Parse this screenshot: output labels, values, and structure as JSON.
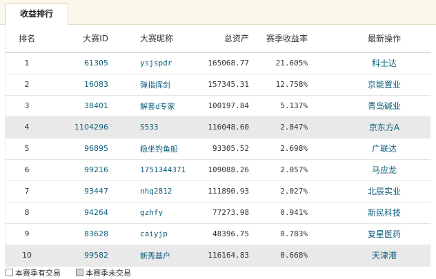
{
  "tab": {
    "label": "收益排行"
  },
  "table": {
    "headers": {
      "rank": "排名",
      "id": "大赛ID",
      "nick": "大赛昵称",
      "asset": "总资产",
      "ret": "赛季收益率",
      "action": "最新操作"
    },
    "rows": [
      {
        "rank": "1",
        "id": "61305",
        "nick": "ysjspdr",
        "asset": "165068.77",
        "ret": "21.605%",
        "action": "科士达",
        "traded": true
      },
      {
        "rank": "2",
        "id": "16083",
        "nick": "弹指挥剑",
        "asset": "157345.31",
        "ret": "12.758%",
        "action": "京能置业",
        "traded": true
      },
      {
        "rank": "3",
        "id": "38401",
        "nick": "解套d专家",
        "asset": "100197.84",
        "ret": "5.137%",
        "action": "青岛碱业",
        "traded": true
      },
      {
        "rank": "4",
        "id": "1104296",
        "nick": "S533",
        "asset": "116048.60",
        "ret": "2.847%",
        "action": "京东方A",
        "traded": false
      },
      {
        "rank": "5",
        "id": "96895",
        "nick": "稳坐钓鱼船",
        "asset": "93305.52",
        "ret": "2.698%",
        "action": "广联达",
        "traded": true
      },
      {
        "rank": "6",
        "id": "99216",
        "nick": "1751344371",
        "asset": "109088.26",
        "ret": "2.057%",
        "action": "马应龙",
        "traded": true
      },
      {
        "rank": "7",
        "id": "93447",
        "nick": "nhq2812",
        "asset": "111890.93",
        "ret": "2.027%",
        "action": "北辰实业",
        "traded": true
      },
      {
        "rank": "8",
        "id": "94264",
        "nick": "gzhfy",
        "asset": "77273.98",
        "ret": "0.941%",
        "action": "新民科技",
        "traded": true
      },
      {
        "rank": "9",
        "id": "83628",
        "nick": "caiyjp",
        "asset": "48396.75",
        "ret": "0.783%",
        "action": "复星医药",
        "traded": true
      },
      {
        "rank": "10",
        "id": "99582",
        "nick": "新秀基户",
        "asset": "116164.83",
        "ret": "0.668%",
        "action": "天津港",
        "traded": false
      }
    ]
  },
  "legend": {
    "traded": "本赛季有交易",
    "untraded": "本赛季未交易"
  },
  "colors": {
    "link": "#0d5e7d",
    "untraded_row": "#e9e9e9",
    "tabbar": "#fbf7ea"
  }
}
